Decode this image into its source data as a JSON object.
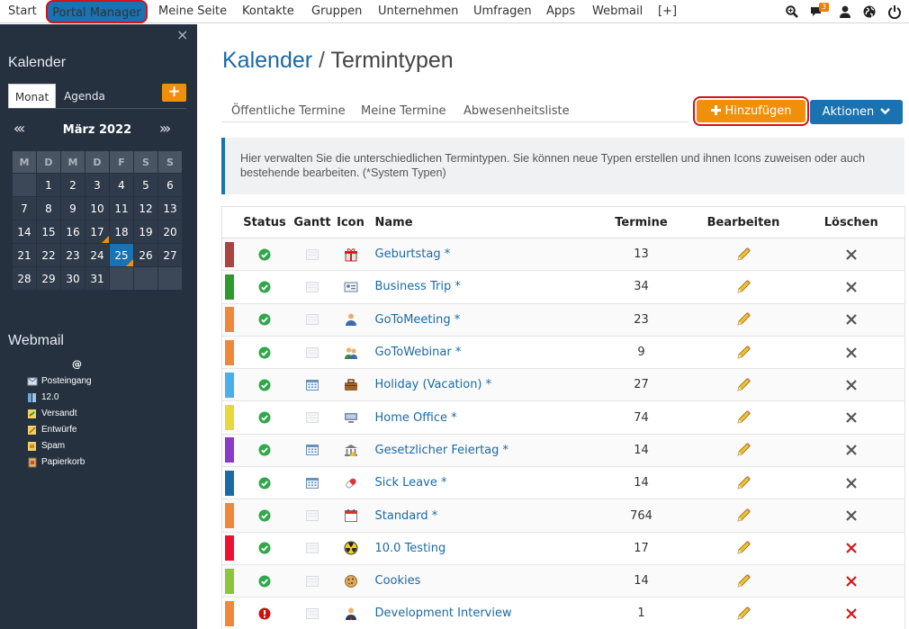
{
  "topnav": {
    "items": [
      "Start",
      "Portal Manager",
      "Meine Seite",
      "Kontakte",
      "Gruppen",
      "Unternehmen",
      "Umfragen",
      "Apps",
      "Webmail",
      "[+]"
    ],
    "active": "Portal Manager",
    "chat_badge": "3"
  },
  "sidebar": {
    "close": "×",
    "calendar_title": "Kalender",
    "tabs": [
      "Monat",
      "Agenda"
    ],
    "add": "+",
    "prev": "«‹",
    "next": "›»",
    "month": "März 2022",
    "weekdays": [
      "M",
      "D",
      "M",
      "D",
      "F",
      "S",
      "S"
    ],
    "weeks": [
      [
        "",
        "1",
        "2",
        "3",
        "4",
        "5",
        "6"
      ],
      [
        "7",
        "8",
        "9",
        "10",
        "11",
        "12",
        "13"
      ],
      [
        "14",
        "15",
        "16",
        "17",
        "18",
        "19",
        "20"
      ],
      [
        "21",
        "22",
        "23",
        "24",
        "25",
        "26",
        "27"
      ],
      [
        "28",
        "29",
        "30",
        "31",
        "",
        "",
        ""
      ]
    ],
    "today": "25",
    "marked_days": [
      "17",
      "25"
    ],
    "webmail_title": "Webmail",
    "webmail_account": "@",
    "folders": [
      "Posteingang",
      "12.0",
      "Versandt",
      "Entwürfe",
      "Spam",
      "Papierkorb"
    ]
  },
  "main": {
    "title": "Kalender",
    "title_sep": "/",
    "title_sub": "Termintypen",
    "tabs": [
      "Öffentliche Termine",
      "Meine Termine",
      "Abwesenheitsliste"
    ],
    "add_button": "Hinzufügen",
    "actions_button": "Aktionen",
    "info": "Hier verwalten Sie die unterschiedlichen Termintypen. Sie können neue Typen erstellen und ihnen Icons zuweisen oder auch bestehende bearbeiten. (*System Typen)"
  },
  "table": {
    "headers": [
      "Status",
      "Gantt",
      "Icon",
      "Name",
      "Termine",
      "Bearbeiten",
      "Löschen"
    ],
    "rows": [
      {
        "color": "#a94442",
        "status": "ok",
        "gantt": false,
        "icon": "gift-icon",
        "name": "Geburtstag *",
        "count": "13",
        "deletable": false
      },
      {
        "color": "#2e9a2e",
        "status": "ok",
        "gantt": false,
        "icon": "id-card-icon",
        "name": "Business Trip *",
        "count": "34",
        "deletable": false
      },
      {
        "color": "#f0883a",
        "status": "ok",
        "gantt": false,
        "icon": "person-icon",
        "name": "GoToMeeting *",
        "count": "23",
        "deletable": false
      },
      {
        "color": "#f0883a",
        "status": "ok",
        "gantt": false,
        "icon": "people-icon",
        "name": "GoToWebinar *",
        "count": "9",
        "deletable": false
      },
      {
        "color": "#4aaee8",
        "status": "ok",
        "gantt": true,
        "icon": "suitcase-icon",
        "name": "Holiday (Vacation) *",
        "count": "27",
        "deletable": false
      },
      {
        "color": "#e8d83a",
        "status": "ok",
        "gantt": false,
        "icon": "computer-icon",
        "name": "Home Office *",
        "count": "74",
        "deletable": false
      },
      {
        "color": "#8a3ac8",
        "status": "ok",
        "gantt": true,
        "icon": "bank-icon",
        "name": "Gesetzlicher Feiertag *",
        "count": "14",
        "deletable": false
      },
      {
        "color": "#1a6aa5",
        "status": "ok",
        "gantt": true,
        "icon": "pill-icon",
        "name": "Sick Leave *",
        "count": "14",
        "deletable": false
      },
      {
        "color": "#f0883a",
        "status": "ok",
        "gantt": false,
        "icon": "calendar-icon",
        "name": "Standard *",
        "count": "764",
        "deletable": false
      },
      {
        "color": "#ee1133",
        "status": "ok",
        "gantt": false,
        "icon": "radiation-icon",
        "name": "10.0 Testing",
        "count": "17",
        "deletable": true
      },
      {
        "color": "#8cc43a",
        "status": "ok",
        "gantt": false,
        "icon": "cookie-icon",
        "name": "Cookies",
        "count": "14",
        "deletable": true
      },
      {
        "color": "#f0883a",
        "status": "error",
        "gantt": false,
        "icon": "businessman-icon",
        "name": "Development Interview",
        "count": "1",
        "deletable": true
      }
    ]
  }
}
